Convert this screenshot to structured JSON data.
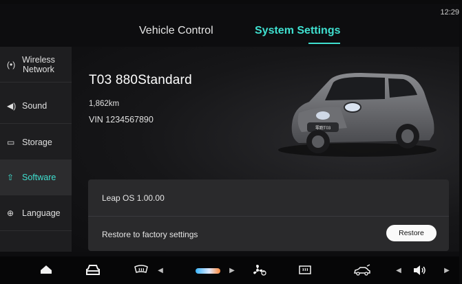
{
  "status": {
    "time": "12:29"
  },
  "tabs": [
    {
      "label": "Vehicle Control",
      "active": false
    },
    {
      "label": "System Settings",
      "active": true
    }
  ],
  "sidebar": {
    "items": [
      {
        "line1": "Wireless",
        "line2": "Network",
        "icon": "wifi-broadcast-icon",
        "glyph": "(•)"
      },
      {
        "label": "Sound",
        "icon": "speaker-icon",
        "glyph": "◀)"
      },
      {
        "label": "Storage",
        "icon": "storage-icon",
        "glyph": "▭"
      },
      {
        "label": "Software",
        "icon": "cloud-upload-icon",
        "glyph": "⇧",
        "active": true
      },
      {
        "label": "Language",
        "icon": "globe-icon",
        "glyph": "⊕"
      }
    ]
  },
  "vehicle": {
    "model": "T03  880Standard",
    "odometer": "1,862km",
    "vin": "VIN 1234567890",
    "plate_text": "零跑T03"
  },
  "software": {
    "os_version": "Leap OS 1.00.00",
    "restore_label": "Restore to factory settings",
    "restore_button": "Restore"
  },
  "dock": {
    "items": [
      "home-icon",
      "car-front-icon",
      "rear-defrost-icon",
      "fan-icon",
      "front-defrost-icon",
      "car-side-icon",
      "volume-icon"
    ],
    "temperature_level": 0.5
  },
  "colors": {
    "accent": "#3fe0d0",
    "panel": "#2a2a2c",
    "sidebar": "#1e1e20"
  }
}
